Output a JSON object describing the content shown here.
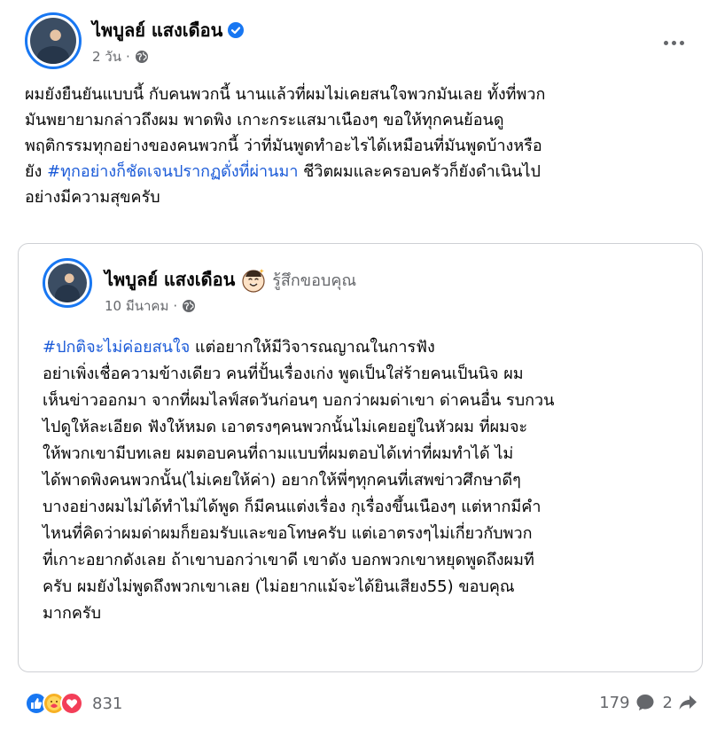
{
  "post": {
    "author": "ไพบูลย์ แสงเดือน",
    "time": "2 วัน",
    "meta_separator": "·",
    "body_lines": [
      "ผมยังยืนยันแบบนี้ กับคนพวกนี้ นานแล้วที่ผมไม่เคยสนใจพวกมันเลย ทั้งที่พวก",
      "มันพยายามกล่าวถึงผม พาดพิง เกาะกระแสมาเนืองๆ ขอให้ทุกคนย้อนดู",
      "พฤติกรรมทุกอย่างของคนพวกนี้ ว่าที่มันพูดทำอะไรได้เหมือนที่มันพูดบ้างหรือ"
    ],
    "body_line4_prefix": "ยัง ",
    "hashtag": "#ทุกอย่างก็ชัดเจนปรากฏดั่งที่ผ่านมา",
    "body_line4_suffix": " ชีวิตผมและครอบครัวก็ยังดำเนินไป",
    "body_line5": "อย่างมีความสุขครับ"
  },
  "shared": {
    "author": "ไพบูลย์ แสงเดือน",
    "feeling": "รู้สึกขอบคุณ",
    "time": "10 มีนาคม",
    "meta_separator": "·",
    "hashtag": "#ปกติจะไม่ค่อยสนใจ",
    "line1_suffix": " แต่อยากให้มีวิจารณญาณในการฟัง",
    "body_lines": [
      "อย่าเพิ่งเชื่อความข้างเดียว คนที่ปั้นเรื่องเก่ง พูดเป็นใส่ร้ายคนเป็นนิจ ผม",
      "เห็นข่าวออกมา จากที่ผมไลฟ์สดวันก่อนๆ บอกว่าผมด่าเขา ด่าคนอื่น รบกวน",
      "ไปดูให้ละเอียด ฟังให้หมด เอาตรงๆคนพวกนั้นไม่เคยอยู่ในหัวผม ที่ผมจะ",
      "ให้พวกเขามีบทเลย ผมตอบคนที่ถามแบบที่ผมตอบได้เท่าที่ผมทำได้ ไม่",
      "ได้พาดพิงคนพวกนั้น(ไม่เคยให้ค่า) อยากให้พี่ๆทุกคนที่เสพข่าวศึกษาดีๆ",
      "บางอย่างผมไม่ได้ทำไม่ได้พูด ก็มีคนแต่งเรื่อง กุเรื่องขึ้นเนืองๆ แต่หากมีคำ",
      "ไหนที่คิดว่าผมด่าผมก็ยอมรับและขอโทษครับ แต่เอาตรงๆไม่เกี่ยวกับพวก",
      "ที่เกาะอยากดังเลย ถ้าเขาบอกว่าเขาดี เขาดัง บอกพวกเขาหยุดพูดถึงผมที",
      "ครับ ผมยังไม่พูดถึงพวกเขาเลย (ไม่อยากแม้จะได้ยินเสียง55) ขอบคุณ",
      "มากครับ"
    ]
  },
  "footer": {
    "reaction_count": "831",
    "comment_count": "179",
    "share_count": "2"
  },
  "colors": {
    "accent": "#1877f2",
    "hashtag": "#1a5ad8",
    "secondary_text": "#65676b",
    "border": "#ced0d4"
  },
  "icons": [
    "verified-badge-icon",
    "globe-icon",
    "more-options-icon",
    "grateful-emoji-icon",
    "like-reaction-icon",
    "care-reaction-icon",
    "love-reaction-icon",
    "comment-icon",
    "share-icon"
  ]
}
